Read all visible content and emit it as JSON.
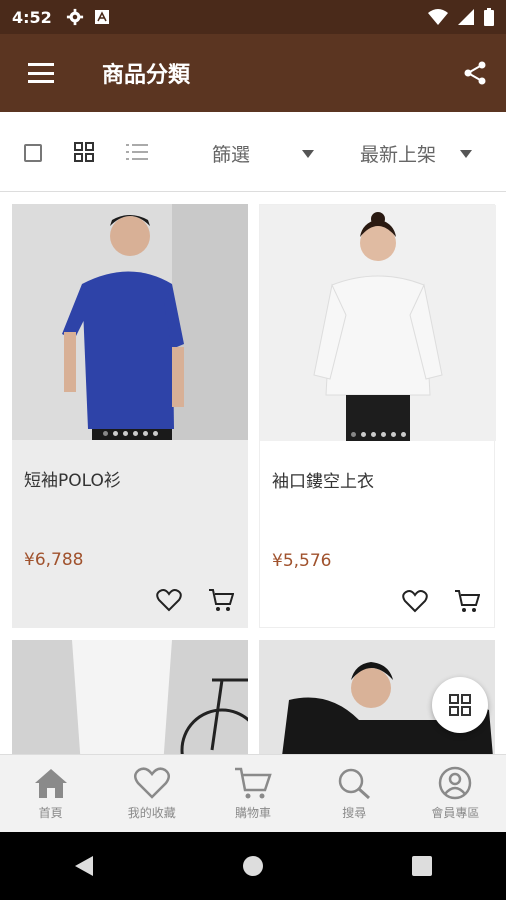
{
  "status": {
    "time": "4:52"
  },
  "appbar": {
    "title": "商品分類"
  },
  "toolbar": {
    "filter_label": "篩選",
    "sort_label": "最新上架"
  },
  "products": [
    {
      "name": "短袖POLO衫",
      "price": "¥6,788"
    },
    {
      "name": "袖口鏤空上衣",
      "price": "¥5,576"
    }
  ],
  "bottom_nav": [
    {
      "label": "首頁",
      "icon": "home-icon"
    },
    {
      "label": "我的收藏",
      "icon": "heart-icon"
    },
    {
      "label": "購物車",
      "icon": "cart-icon"
    },
    {
      "label": "搜尋",
      "icon": "search-icon"
    },
    {
      "label": "會員專區",
      "icon": "user-icon"
    }
  ],
  "colors": {
    "status_bar": "#4a2a1a",
    "app_bar": "#5b3521",
    "price": "#a0522d"
  }
}
